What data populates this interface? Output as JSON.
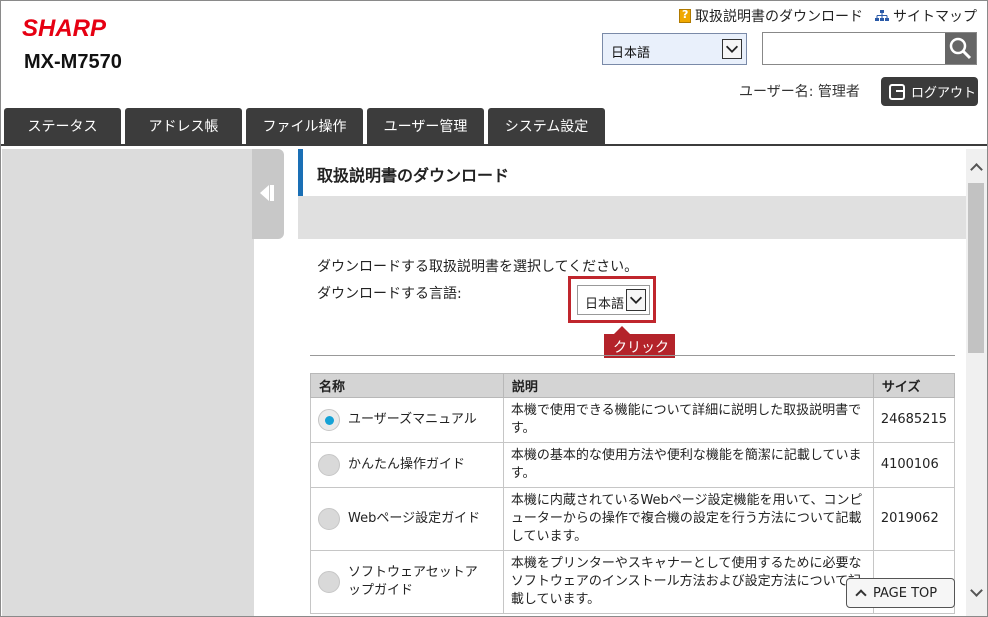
{
  "header": {
    "brand": "SHARP",
    "model": "MX-M7570",
    "links": [
      {
        "label": "取扱説明書のダウンロード",
        "icon": "manual-icon"
      },
      {
        "label": "サイトマップ",
        "icon": "sitemap-icon"
      }
    ],
    "language_select": {
      "value": "日本語"
    },
    "search": {
      "placeholder": ""
    },
    "user_label": "ユーザー名: 管理者",
    "logout_label": "ログアウト"
  },
  "tabs": [
    "ステータス",
    "アドレス帳",
    "ファイル操作",
    "ユーザー管理",
    "システム設定"
  ],
  "main": {
    "title": "取扱説明書のダウンロード",
    "instruction": "ダウンロードする取扱説明書を選択してください。",
    "lang_label": "ダウンロードする言語:",
    "lang_value": "日本語",
    "callout": "クリック",
    "table": {
      "headers": [
        "名称",
        "説明",
        "サイズ"
      ],
      "rows": [
        {
          "name": "ユーザーズマニュアル",
          "desc": "本機で使用できる機能について詳細に説明した取扱説明書です。",
          "size": "24685215",
          "selected": true
        },
        {
          "name": "かんたん操作ガイド",
          "desc": "本機の基本的な使用方法や便利な機能を簡潔に記載しています。",
          "size": "4100106",
          "selected": false
        },
        {
          "name": "Webページ設定ガイド",
          "desc": "本機に内蔵されているWebページ設定機能を用いて、コンピューターからの操作で複合機の設定を行う方法について記載しています。",
          "size": "2019062",
          "selected": false
        },
        {
          "name": "ソフトウェアセットアップガイド",
          "desc": "本機をプリンターやスキャナーとして使用するために必要なソフトウェアのインストール方法および設定方法について記載しています。",
          "size": "",
          "selected": false
        }
      ]
    }
  },
  "page_top_label": "PAGE TOP",
  "colors": {
    "brand": "#e60012",
    "accent": "#1a6fb5",
    "highlight": "#c0262d",
    "radio_on": "#15a2d6"
  }
}
